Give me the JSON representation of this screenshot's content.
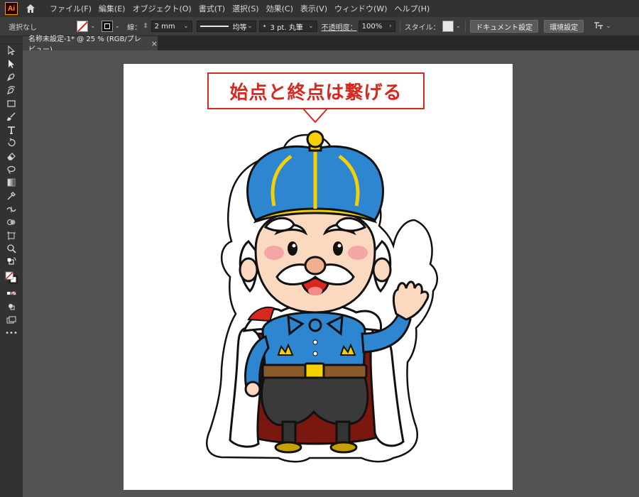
{
  "app": {
    "logo_text": "Ai"
  },
  "menu": {
    "items": [
      "ファイル(F)",
      "編集(E)",
      "オブジェクト(O)",
      "書式(T)",
      "選択(S)",
      "効果(C)",
      "表示(V)",
      "ウィンドウ(W)",
      "ヘルプ(H)"
    ]
  },
  "control": {
    "selection": "選択なし",
    "stroke_label": "線：",
    "stroke_weight": "2 mm",
    "profile": "均等",
    "brush": "3 pt. 丸筆",
    "opacity_label": "不透明度：",
    "opacity": "100%",
    "style_label": "スタイル：",
    "doc_setup": "ドキュメント設定",
    "prefs": "環境設定"
  },
  "document": {
    "tab_title": "名称未設定-1* @ 25 % (RGB/プレビュー)",
    "close": "×"
  },
  "artwork": {
    "callout_text": "始点と終点は繋げる"
  },
  "colors": {
    "accent_red": "#d8281f",
    "crown_blue": "#2e86d0",
    "gold": "#f5d100",
    "cape_red": "#7a1810",
    "fur_white": "#ffffff"
  },
  "tools": [
    "selection-tool",
    "direct-selection-tool",
    "pen-tool",
    "curvature-tool",
    "rectangle-tool",
    "paintbrush-tool",
    "type-tool",
    "rotate-tool",
    "eraser-tool",
    "lasso-tool",
    "gradient-tool",
    "eyedropper-tool",
    "width-tool",
    "shape-builder-tool",
    "artboard-tool",
    "zoom-tool",
    "fill-stroke-defaults",
    "fill-none-swatch",
    "color-mode",
    "draw-mode",
    "screen-mode",
    "more-tools"
  ],
  "more_tools_glyph": "•••"
}
